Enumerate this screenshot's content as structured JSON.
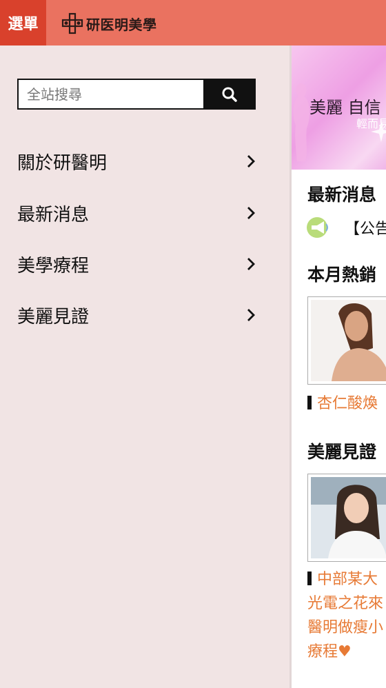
{
  "header": {
    "menu_label": "選單",
    "brand_name": "研医明美學",
    "colors": {
      "bar": "#ea7260",
      "menu_button": "#d9412c"
    }
  },
  "drawer": {
    "search": {
      "placeholder": "全站搜尋",
      "button_icon": "search-icon"
    },
    "items": [
      {
        "label": "關於研醫明"
      },
      {
        "label": "最新消息"
      },
      {
        "label": "美學療程"
      },
      {
        "label": "美麗見證"
      }
    ],
    "background": "#f1e4e4"
  },
  "main": {
    "banner": {
      "title": "美麗 自信",
      "subtitle": "輕而易"
    },
    "news_title": "最新消息",
    "news_item": "【公告",
    "hot_title": "本月熱銷",
    "hot_caption": "杏仁酸煥",
    "testimony_title": "美麗見證",
    "testimony_caption_lines": [
      "中部某大",
      "光電之花來",
      "醫明做瘦小",
      "療程♥"
    ],
    "accent_color": "#e77a35"
  }
}
